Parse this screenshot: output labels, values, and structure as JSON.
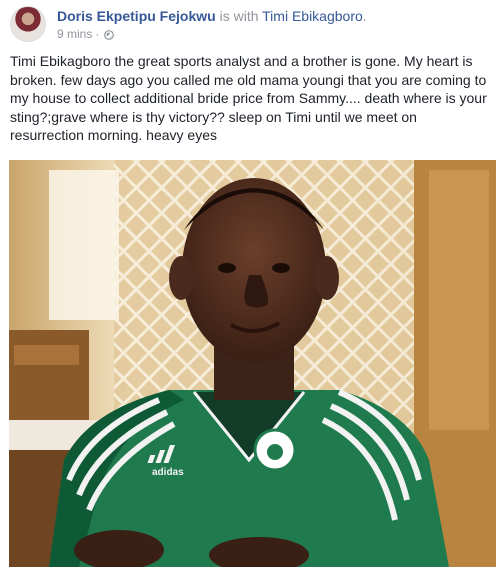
{
  "post": {
    "author": "Doris Ekpetipu Fejokwu",
    "with_text": " is with ",
    "tagged": "Timi Ebikagboro",
    "tagged_suffix": ".",
    "timestamp": "9 mins",
    "separator": "·",
    "privacy_icon": "globe-icon",
    "text": "Timi Ebikagboro the great sports analyst and a brother is gone. My heart is broken. few days ago you called me old mama youngi that you are coming to my house to collect additional bride price from Sammy.... death where is your sting?;grave where is thy victory?? sleep on Timi until we meet on resurrection morning. heavy eyes"
  },
  "photo": {
    "jersey_brand": "adidas",
    "colors": {
      "jersey": "#1f7a4d",
      "jersey_dark": "#0f5a36",
      "stripes": "#f2f2f2",
      "wall": "#e9d3a8",
      "lattice": "#f5ead5"
    }
  },
  "theme": {
    "link": "#365899",
    "text": "#1d2129",
    "meta": "#90949c"
  }
}
